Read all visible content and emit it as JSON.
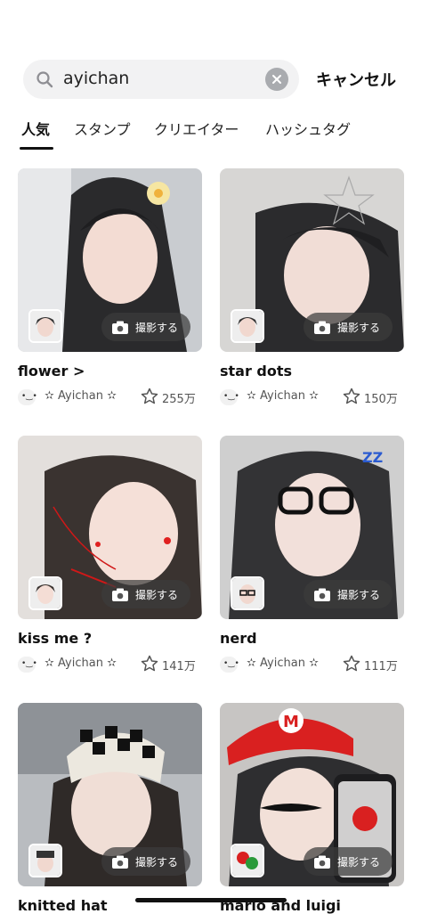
{
  "search": {
    "query": "ayichan",
    "cancel_label": "キャンセル"
  },
  "tabs": [
    {
      "label": "人気",
      "active": true
    },
    {
      "label": "スタンプ",
      "active": false
    },
    {
      "label": "クリエイター",
      "active": false
    },
    {
      "label": "ハッシュタグ",
      "active": false
    }
  ],
  "capture_label": "撮影する",
  "cards": [
    {
      "title": "flower >",
      "author": "✫ Ayichan ✫",
      "count": "255万"
    },
    {
      "title": "star dots",
      "author": "✫ Ayichan ✫",
      "count": "150万"
    },
    {
      "title": "kiss me ?",
      "author": "✫ Ayichan ✫",
      "count": "141万"
    },
    {
      "title": "nerd",
      "author": "✫ Ayichan ✫",
      "count": "111万"
    },
    {
      "title": "knitted hat",
      "author": "",
      "count": ""
    },
    {
      "title": "mario and luigi",
      "author": "",
      "count": ""
    }
  ],
  "colors": {
    "accent": "#111111",
    "search_bg": "#f2f2f3",
    "capture_bg": "#3c3c3c"
  }
}
